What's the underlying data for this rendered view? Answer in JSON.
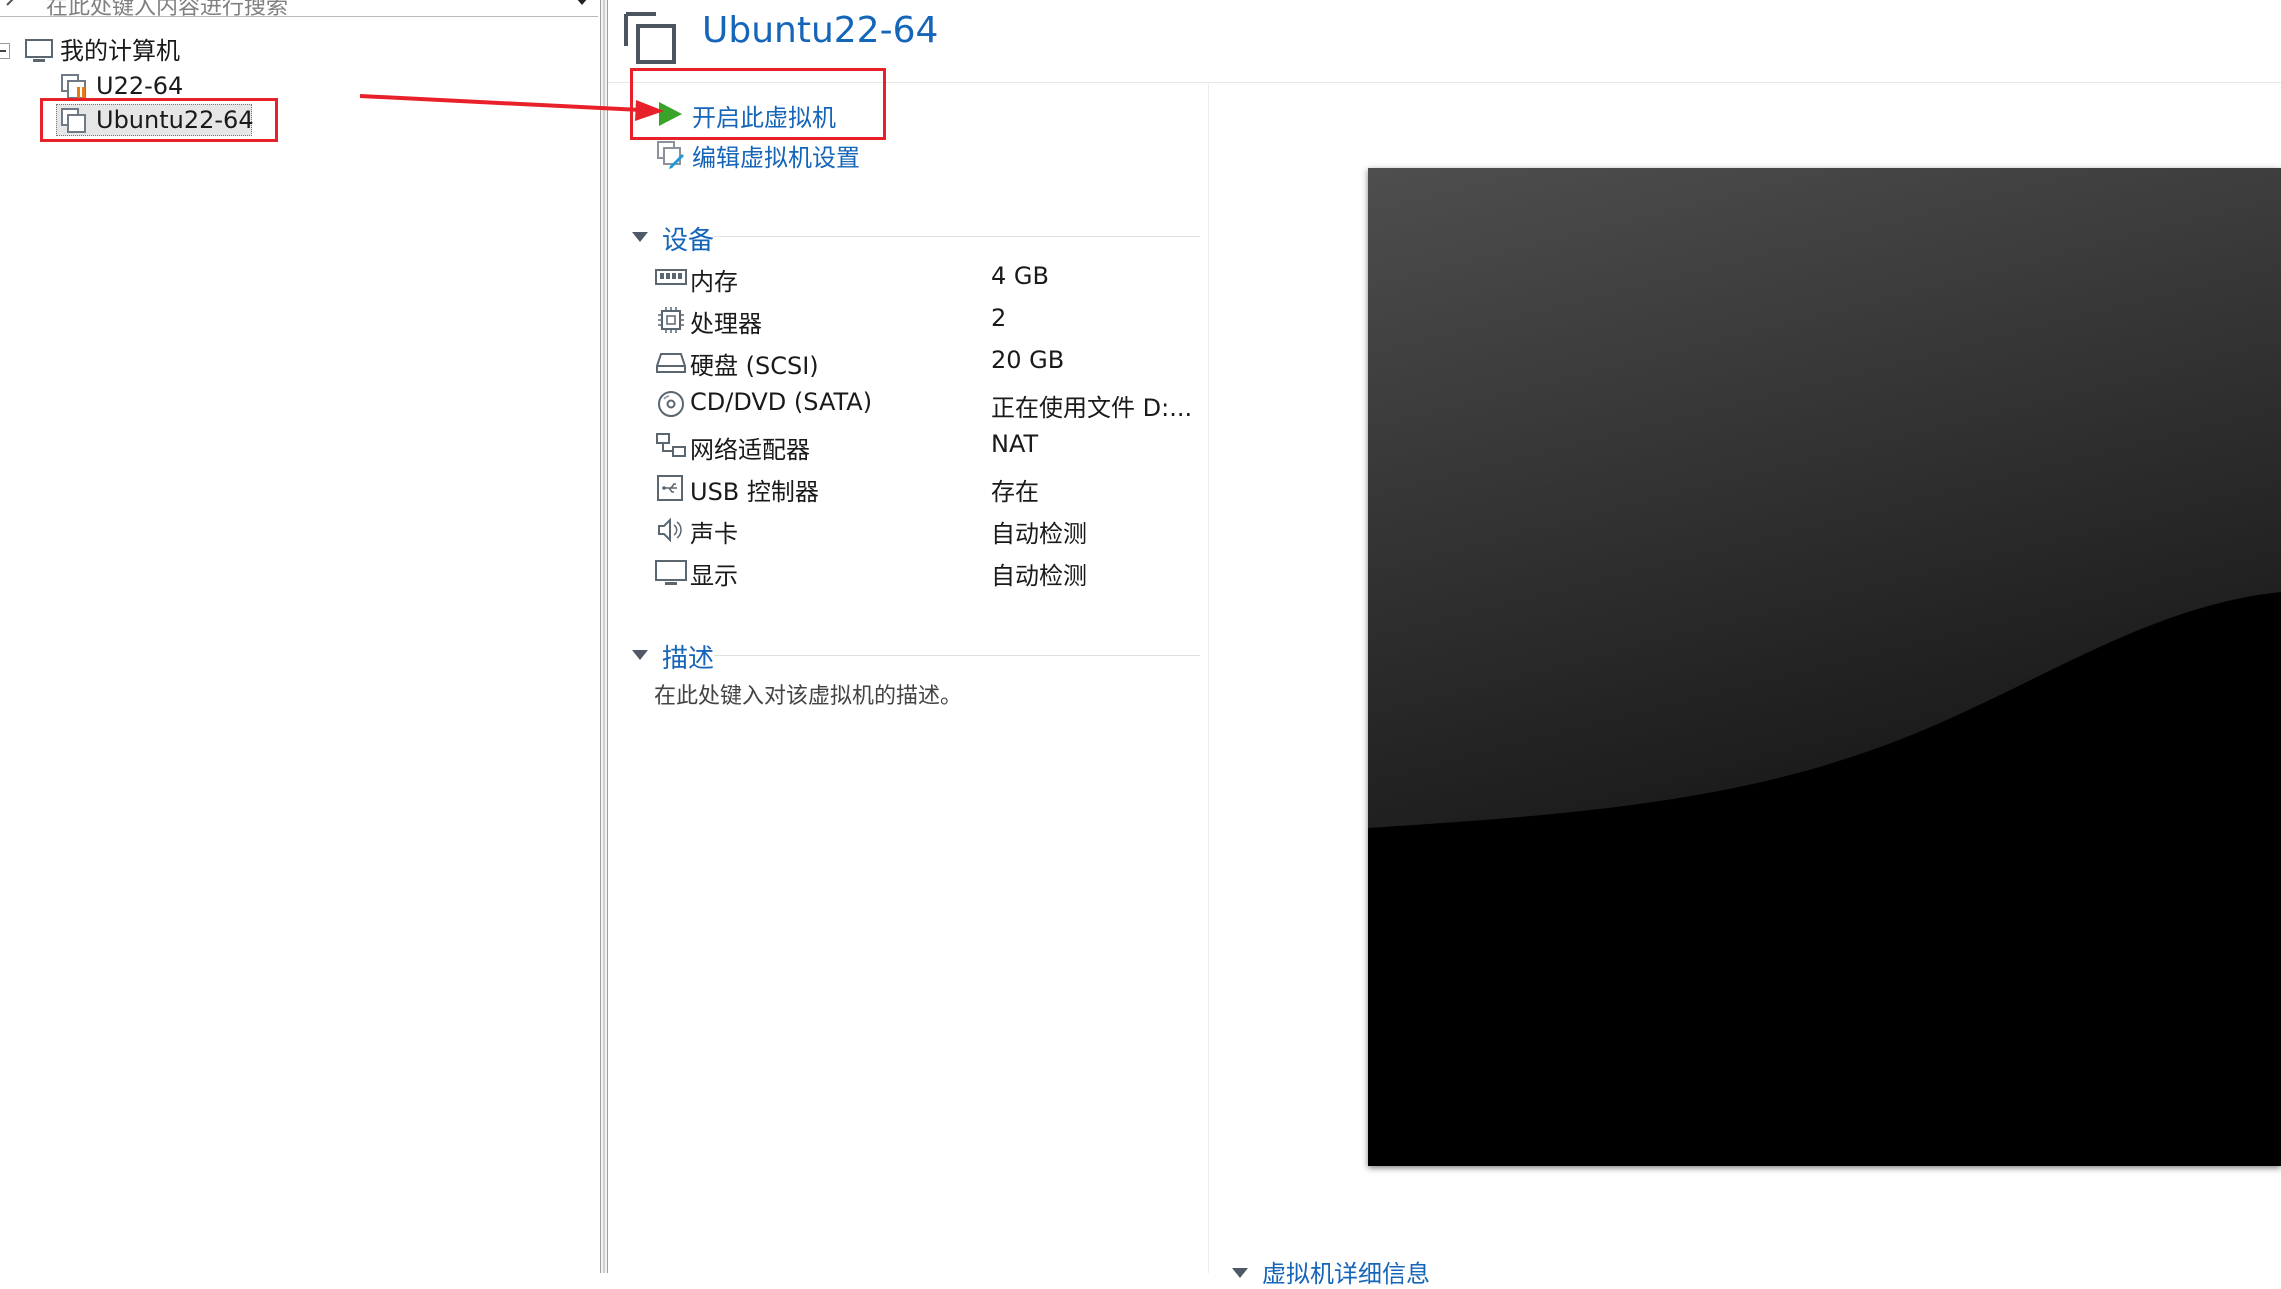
{
  "search": {
    "placeholder": "在此处键入内容进行搜索"
  },
  "library": {
    "root_label": "我的计算机",
    "vms": [
      {
        "label": "U22-64",
        "running": false
      },
      {
        "label": "Ubuntu22-64",
        "selected": true
      }
    ]
  },
  "vm": {
    "title": "Ubuntu22-64"
  },
  "actions": {
    "power_on": "开启此虚拟机",
    "edit_settings": "编辑虚拟机设置"
  },
  "devices": {
    "section_title": "设备",
    "items": [
      {
        "name": "内存",
        "value": "4 GB",
        "icon": "memory-icon"
      },
      {
        "name": "处理器",
        "value": "2",
        "icon": "processor-icon"
      },
      {
        "name": "硬盘 (SCSI)",
        "value": "20 GB",
        "icon": "hard-disk-icon"
      },
      {
        "name": "CD/DVD (SATA)",
        "value": "正在使用文件 D:...",
        "icon": "cd-dvd-icon"
      },
      {
        "name": "网络适配器",
        "value": "NAT",
        "icon": "network-adapter-icon"
      },
      {
        "name": "USB 控制器",
        "value": "存在",
        "icon": "usb-icon"
      },
      {
        "name": "声卡",
        "value": "自动检测",
        "icon": "sound-card-icon"
      },
      {
        "name": "显示",
        "value": "自动检测",
        "icon": "display-icon"
      }
    ]
  },
  "description": {
    "section_title": "描述",
    "placeholder": "在此处键入对该虚拟机的描述。"
  },
  "details": {
    "section_title": "虚拟机详细信息"
  },
  "colors": {
    "link_blue": "#1565b8",
    "annotation_red": "#e8202a",
    "play_green": "#3aa329"
  }
}
